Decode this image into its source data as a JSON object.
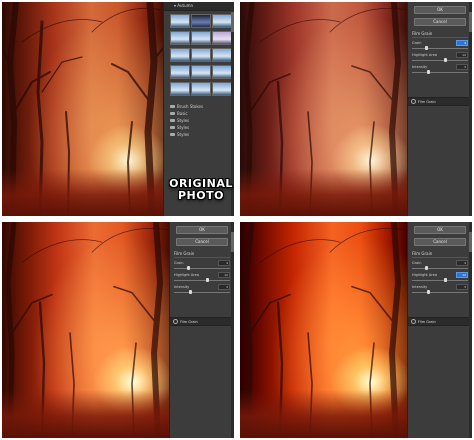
{
  "overlay_label": [
    "ORIGINAL",
    "PHOTO"
  ],
  "library": {
    "folder_label": "Autumn",
    "thumbnails": [
      {
        "style": "sky"
      },
      {
        "style": "night"
      },
      {
        "style": "sky"
      },
      {
        "style": "sky"
      },
      {
        "style": "sky"
      },
      {
        "style": "violet"
      },
      {
        "style": "sky"
      },
      {
        "style": "sky"
      },
      {
        "style": "sky"
      },
      {
        "style": "sky"
      },
      {
        "style": "sky"
      },
      {
        "style": "sky"
      },
      {
        "style": "sky"
      },
      {
        "style": "sky"
      },
      {
        "style": "sky"
      }
    ],
    "folders": [
      "Brush Stokes",
      "Basic",
      "Styles",
      "Styles",
      "Styles"
    ]
  },
  "filter_panel": {
    "ok_label": "OK",
    "cancel_label": "Cancel",
    "section_title": "Film Grain",
    "params": [
      {
        "label": "Grain",
        "value": "4",
        "fraction": 0.25
      },
      {
        "label": "Highlight Area",
        "value": "12",
        "fraction": 0.6
      },
      {
        "label": "Intensity",
        "value": "3",
        "fraction": 0.3
      }
    ],
    "layer_label": "Film Grain"
  },
  "panel_states": [
    {
      "highlight_index": 0
    },
    {
      "highlight_index": -1
    },
    {
      "highlight_index": 1
    }
  ],
  "colors": {
    "panel_bg": "#3c3c3c",
    "highlight_field": "#2d74d6"
  },
  "icons": [
    "folder-icon",
    "eye-icon",
    "collapse-arrow-icon"
  ]
}
